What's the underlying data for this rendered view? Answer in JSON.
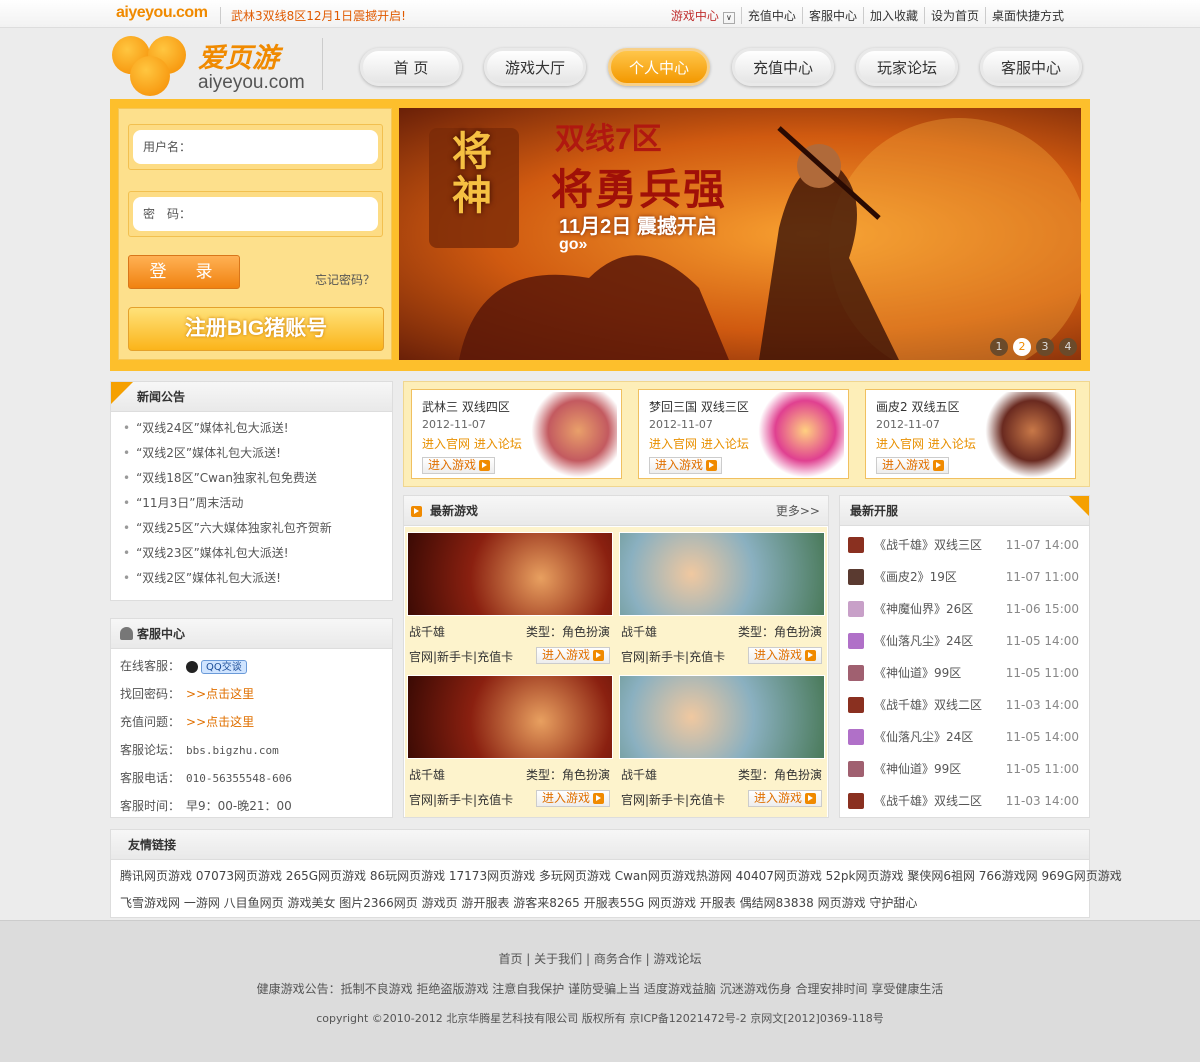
{
  "topbar": {
    "mini_logo": "aiyeyou.com",
    "notice": "武林3双线8区12月1日震撼开启!",
    "links": [
      "游戏中心",
      "充值中心",
      "客服中心",
      "加入收藏",
      "设为首页",
      "桌面快捷方式"
    ]
  },
  "logo": {
    "cn": "爱页游",
    "en": "aiyeyou.com"
  },
  "nav": [
    "首 页",
    "游戏大厅",
    "个人中心",
    "充值中心",
    "玩家论坛",
    "客服中心"
  ],
  "nav_active": "个人中心",
  "login": {
    "username_label": "用户名：",
    "password_label": "密　码：",
    "login_button": "登　录",
    "forgot": "忘记密码？",
    "register_button": "注册BIG猪账号"
  },
  "banner": {
    "badge": "将神",
    "line1": "双线7区",
    "line2": "将勇兵强",
    "line3": "11月2日 震撼开启",
    "go": "go»",
    "pages": [
      "1",
      "2",
      "3",
      "4"
    ],
    "current_page": "2"
  },
  "news": {
    "title": "新闻公告",
    "items": [
      "“双线24区”媒体礼包大派送!",
      "“双线2区”媒体礼包大派送!",
      "“双线18区”Cwan独家礼包免费送",
      "“11月3日”周末活动",
      "“双线25区”六大媒体独家礼包齐贺新",
      "“双线23区”媒体礼包大派送!",
      "“双线2区”媒体礼包大派送!"
    ]
  },
  "service": {
    "title": "客服中心",
    "rows": [
      {
        "label": "在线客服：",
        "value": "QQ交谈"
      },
      {
        "label": "找回密码：",
        "value": ">>点击这里"
      },
      {
        "label": "充值问题：",
        "value": ">>点击这里"
      },
      {
        "label": "客服论坛：",
        "value": "bbs.bigzhu.com"
      },
      {
        "label": "客服电话：",
        "value": "010-56355548-606"
      },
      {
        "label": "客服时间：",
        "value": "早9：00-晚21：00"
      }
    ]
  },
  "promos": [
    {
      "title": "武林三  双线四区",
      "date": "2012-11-07",
      "links": "进入官网  进入论坛",
      "button": "进入游戏"
    },
    {
      "title": "梦回三国  双线三区",
      "date": "2012-11-07",
      "links": "进入官网  进入论坛",
      "button": "进入游戏"
    },
    {
      "title": "画皮2  双线五区",
      "date": "2012-11-07",
      "links": "进入官网  进入论坛",
      "button": "进入游戏"
    }
  ],
  "latest_games": {
    "title": "最新游戏",
    "more": "更多>>",
    "items": [
      {
        "name": "战千雄",
        "type": "类型：角色扮演",
        "links": "官网|新手卡|充值卡",
        "button": "进入游戏"
      },
      {
        "name": "战千雄",
        "type": "类型：角色扮演",
        "links": "官网|新手卡|充值卡",
        "button": "进入游戏"
      },
      {
        "name": "战千雄",
        "type": "类型：角色扮演",
        "links": "官网|新手卡|充值卡",
        "button": "进入游戏"
      },
      {
        "name": "战千雄",
        "type": "类型：角色扮演",
        "links": "官网|新手卡|充值卡",
        "button": "进入游戏"
      }
    ]
  },
  "servers": {
    "title": "最新开服",
    "items": [
      {
        "name": "《战千雄》双线三区",
        "time": "11-07 14:00"
      },
      {
        "name": "《画皮2》19区",
        "time": "11-07 11:00"
      },
      {
        "name": "《神魔仙界》26区",
        "time": "11-06 15:00"
      },
      {
        "name": "《仙落凡尘》24区",
        "time": "11-05 14:00"
      },
      {
        "name": "《神仙道》99区",
        "time": "11-05 11:00"
      },
      {
        "name": "《战千雄》双线二区",
        "time": "11-03 14:00"
      },
      {
        "name": "《仙落凡尘》24区",
        "time": "11-05 14:00"
      },
      {
        "name": "《神仙道》99区",
        "time": "11-05 11:00"
      },
      {
        "name": "《战千雄》双线二区",
        "time": "11-03 14:00"
      }
    ]
  },
  "friend_links": {
    "title": "友情链接",
    "row1": "腾讯网页游戏  07073网页游戏  265G网页游戏  86玩网页游戏  17173网页游戏  多玩网页游戏  Cwan网页游戏热游网  40407网页游戏  52pk网页游戏  聚侠网6祖网  766游戏网  969G网页游戏",
    "row2": "飞雪游戏网  一游网  八目鱼网页  游戏美女  图片2366网页  游戏页  游开服表  游客来8265  开服表55G  网页游戏  开服表  偶结网83838  网页游戏  守护甜心"
  },
  "footer": {
    "links": "首页  |  关于我们  |  商务合作  |  游戏论坛",
    "health": "健康游戏公告：抵制不良游戏  拒绝盗版游戏  注意自我保护  谨防受骗上当  适度游戏益脑  沉迷游戏伤身  合理安排时间  享受健康生活",
    "copyright": "copyright ©2010-2012 北京华腾星艺科技有限公司 版权所有 京ICP备12021472号-2 京网文[2012]0369-118号"
  },
  "colors": {
    "accent": "#f39800",
    "hero_bg": "#fdbf2c",
    "link_orange": "#e07000"
  }
}
